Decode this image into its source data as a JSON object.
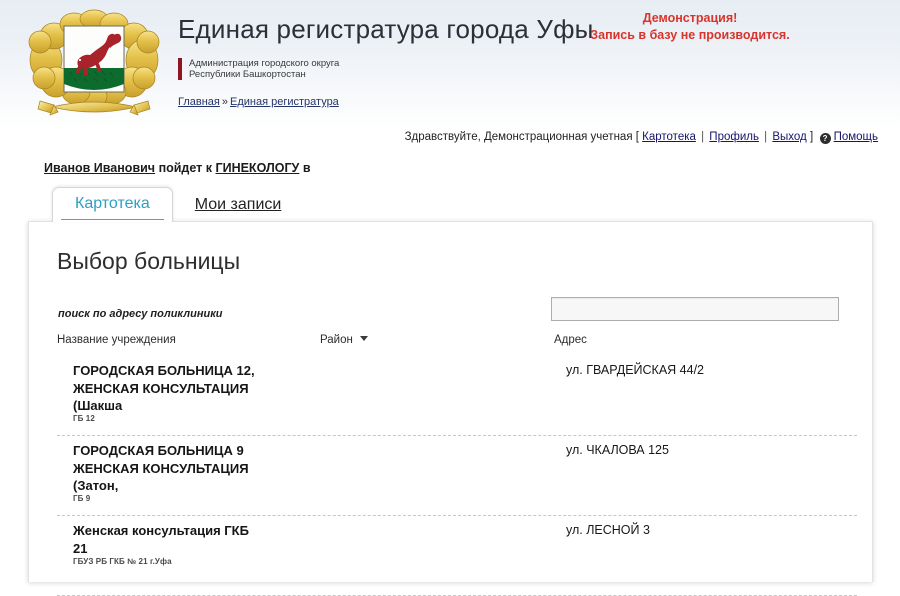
{
  "header": {
    "title": "Единая регистратура города Уфы",
    "subtitle": "Администрация городского округа\nРеспублики Башкортостан",
    "emblem_name": "ufa-coat-of-arms",
    "breadcrumb": {
      "home": "Главная",
      "separator": "»",
      "current": "Единая регистратура"
    },
    "demo_warning": {
      "line1": "Демонстрация!",
      "line2": "Запись в базу не производится.",
      "color": "#d9342b"
    }
  },
  "userbar": {
    "greeting": "Здравствуйте, Демонстрационная учетная",
    "bracket_open": "[",
    "bracket_close": "]",
    "pipe": "|",
    "links": {
      "cardfile": "Картотека",
      "profile": "Профиль",
      "logout": "Выход",
      "help": "Помощь"
    },
    "help_icon_glyph": "?"
  },
  "patient": {
    "name": "Иванов Иванович",
    "middle_text": "пойдет к",
    "doctor": "ГИНЕКОЛОГУ",
    "tail_text": "в"
  },
  "tabs": [
    {
      "label": "Картотека",
      "active": true
    },
    {
      "label": "Мои записи",
      "active": false
    }
  ],
  "panel": {
    "title": "Выбор больницы",
    "search": {
      "label": "поиск по адресу поликлиники",
      "value": "",
      "placeholder": ""
    },
    "table": {
      "columns": {
        "name": "Название учреждения",
        "district": "Район",
        "address": "Адрес"
      },
      "district_sortable": true,
      "rows": [
        {
          "name": "ГОРОДСКАЯ БОЛЬНИЦА 12,\nЖЕНСКАЯ КОНСУЛЬТАЦИЯ\n(Шакша",
          "sub": "ГБ 12",
          "district": "",
          "address": "ул. ГВАРДЕЙСКАЯ 44/2"
        },
        {
          "name": "ГОРОДСКАЯ БОЛЬНИЦА 9\nЖЕНСКАЯ КОНСУЛЬТАЦИЯ\n(Затон,",
          "sub": "ГБ 9",
          "district": "",
          "address": "ул. ЧКАЛОВА 125"
        },
        {
          "name": "Женская консультация ГКБ\n21",
          "sub": "ГБУЗ РБ ГКБ № 21 г.Уфа",
          "district": "",
          "address": "ул. ЛЕСНОЙ 3"
        }
      ]
    }
  },
  "theme": {
    "accent_tab": "#2f9fc4",
    "link": "#15146e",
    "warning": "#d9342b",
    "subtitle_bar": "#8e1623"
  }
}
